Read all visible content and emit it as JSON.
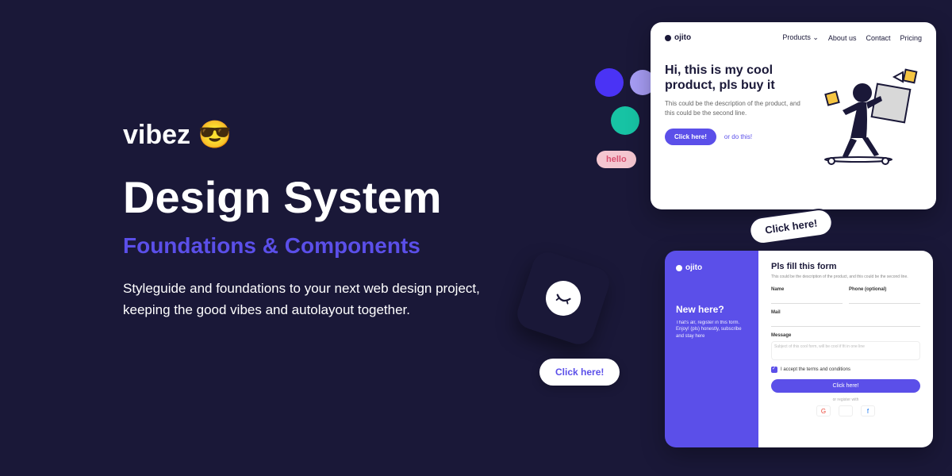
{
  "brand": "vibez 😎",
  "main_title": "Design System",
  "subtitle": "Foundations & Components",
  "description": "Styleguide and foundations to your next web design project, keeping the good vibes and autolayout together.",
  "pill": "hello",
  "bubbles": {
    "b1": "Click here!",
    "b2": "Click here!"
  },
  "mock1": {
    "logo": "ojito",
    "nav": [
      "Products ⌄",
      "About us",
      "Contact",
      "Pricing"
    ],
    "hero_title": "Hi, this is my cool product, pls buy it",
    "hero_desc": "This could be the description of the product, and this could be the second line.",
    "cta": "Click here!",
    "cta_link": "or do this!"
  },
  "mock2": {
    "logo": "ojito",
    "side_heading": "New here?",
    "side_desc": "That's alr, register in this form. Enjoy! (pls) honestly, subscribe and stay here",
    "form_title": "Pls fill this form",
    "form_desc": "This could be the description of the product, and this could be the second line.",
    "labels": {
      "name": "Name",
      "phone": "Phone (optional)",
      "mail": "Mail",
      "message": "Message"
    },
    "placeholder": "Subject of this cool form, will be cool if fit in one line",
    "terms": "I accept the terms and conditions",
    "submit": "Click here!",
    "or": "or register with",
    "socials": [
      "G",
      "",
      "f"
    ]
  },
  "colors": {
    "bg": "#1a1838",
    "accent": "#5b4fe9",
    "teal": "#17c3a4",
    "lilac": "#a79df5",
    "pink": "#f4c6d0"
  }
}
